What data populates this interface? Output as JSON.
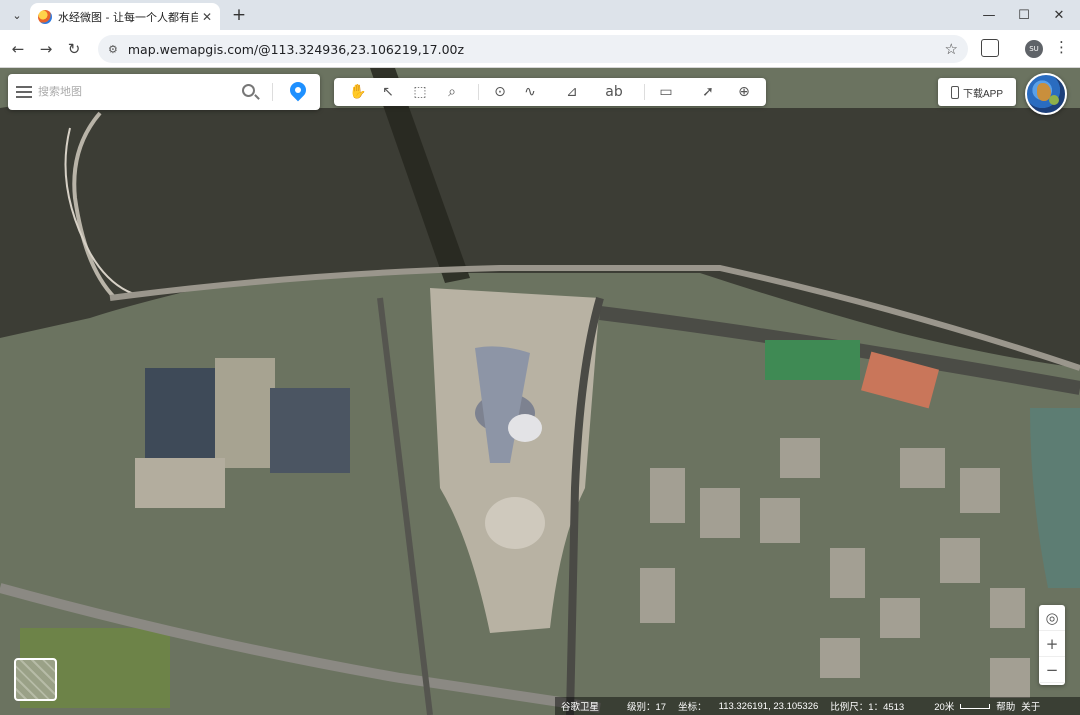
{
  "browser": {
    "tab_title": "水经微图 - 让每一个人都有自己",
    "url": "map.wemapgis.com/@113.324936,23.106219,17.00z",
    "profile_initials": "SU"
  },
  "map": {
    "search_placeholder": "搜索地图",
    "download_label": "下载APP",
    "zoom_in": "+",
    "zoom_out": "−",
    "status": {
      "layer": "谷歌卫星",
      "level": "级别：17",
      "coord_label": "坐标：",
      "coords": "113.326191, 23.105326",
      "scale": "比例尺：1：4513",
      "distance": "20米",
      "help": "帮助",
      "about": "关于"
    },
    "tools": [
      "hand-icon",
      "select-icon",
      "box-select-icon",
      "zoom-area-icon",
      "marker-icon",
      "polyline-icon",
      "polygon-icon",
      "label-icon",
      "measure-icon",
      "pointer-info-icon",
      "globe-icon"
    ],
    "colors": {
      "water": "#3a3b33",
      "land": "#6d7561",
      "pin": "#1e90ff"
    }
  }
}
